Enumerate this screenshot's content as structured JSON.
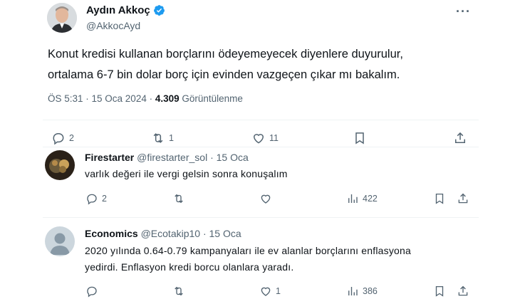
{
  "tweet": {
    "author_name": "Aydın Akkoç",
    "author_handle": "@AkkocAyd",
    "text_line1": "Konut kredisi kullanan borçlarını ödeyemeyecek diyenlere duyurulur,",
    "text_line2": "ortalama 6-7 bin dolar borç için evinden vazgeçen çıkar mı bakalım.",
    "time": "ÖS 5:31 · 15 Oca 2024 · ",
    "views": "4.309",
    "views_label": " Görüntülenme",
    "actions": {
      "replies": "2",
      "retweets": "1",
      "likes": "11"
    }
  },
  "replies": [
    {
      "name": "Firestarter",
      "handle": "@firestarter_sol",
      "date": "· 15 Oca",
      "text": "varlık değeri ile vergi gelsin sonra konuşalım",
      "actions": {
        "replies": "2",
        "retweets": "",
        "likes": "",
        "views": "422"
      }
    },
    {
      "name": "Economics",
      "handle": "@Ecotakip10",
      "date": "· 15 Oca",
      "text_line1": "2020 yılında 0.64-0.79 kampanyaları ile ev alanlar borçlarını enflasyona",
      "text_line2": "yedirdi. Enflasyon kredi borcu olanlara yaradı.",
      "actions": {
        "replies": "",
        "retweets": "",
        "likes": "1",
        "views": "386"
      }
    }
  ],
  "colors": {
    "accent": "#1d9bf0",
    "muted": "#536471",
    "text": "#0f1419"
  }
}
